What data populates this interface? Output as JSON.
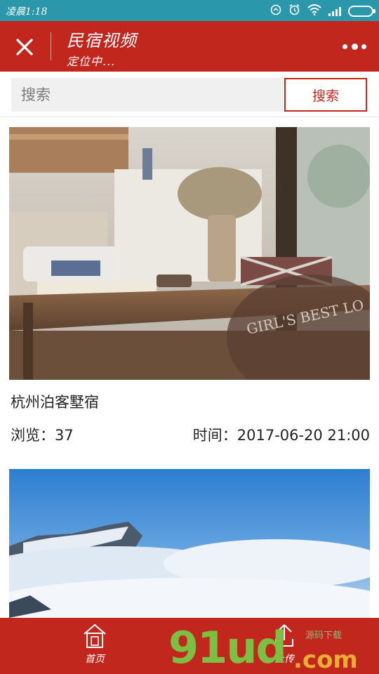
{
  "status_bar": {
    "time": "凌晨1:18",
    "icons": [
      "data-sync-icon",
      "alarm-icon",
      "wifi-icon",
      "signal-icon",
      "battery-icon"
    ]
  },
  "header": {
    "title": "民宿视频",
    "subtitle": "定位中...",
    "close_icon": "close-icon",
    "more_icon": "more-dots-icon"
  },
  "search": {
    "placeholder": "搜索",
    "button_label": "搜索"
  },
  "listings": [
    {
      "title": "杭州泊客墅宿",
      "views": "浏览：37",
      "time": "时间：2017-06-20 21:00"
    },
    {}
  ],
  "tabbar": {
    "items": [
      {
        "label": "首页",
        "icon": "home-icon"
      },
      {
        "label": "上传",
        "icon": "upload-icon"
      }
    ]
  },
  "watermark": {
    "main": "91ud",
    "domain": ".com",
    "small": "源码下载"
  },
  "colors": {
    "accent": "#c1271d",
    "status_bar": "#2a97aa",
    "search_bg": "#f0f0f0"
  }
}
